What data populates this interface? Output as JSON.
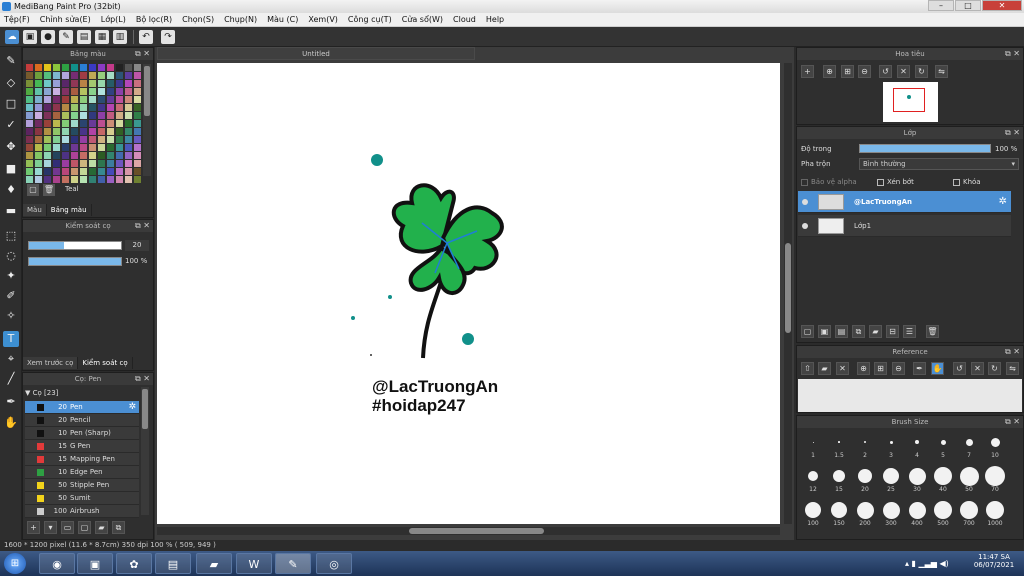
{
  "window": {
    "title": "MediBang Paint Pro (32bit)"
  },
  "menu": [
    "Tệp(F)",
    "Chỉnh sửa(E)",
    "Lớp(L)",
    "Bộ lọc(R)",
    "Chọn(S)",
    "Chụp(N)",
    "Màu (C)",
    "Xem(V)",
    "Công cụ(T)",
    "Cửa sổ(W)",
    "Cloud",
    "Help"
  ],
  "color_panel": {
    "title": "Bảng màu",
    "color_name": "Teal",
    "tab_color": "Màu",
    "tab_palette": "Bảng màu"
  },
  "brush_control": {
    "title": "Kiểm soát cọ",
    "size": "20",
    "opacity": "100 %",
    "tab_preview": "Xem trước cọ",
    "tab_control": "Kiểm soát cọ"
  },
  "brush_panel": {
    "title": "Cọ: Pen",
    "group": "Cọ [23]",
    "items": [
      {
        "size": "20",
        "name": "Pen",
        "color": "#111111"
      },
      {
        "size": "20",
        "name": "Pencil",
        "color": "#111111"
      },
      {
        "size": "10",
        "name": "Pen (Sharp)",
        "color": "#111111"
      },
      {
        "size": "15",
        "name": "G Pen",
        "color": "#e23a3a"
      },
      {
        "size": "15",
        "name": "Mapping Pen",
        "color": "#e23a3a"
      },
      {
        "size": "10",
        "name": "Edge Pen",
        "color": "#2ea043"
      },
      {
        "size": "50",
        "name": "Stipple Pen",
        "color": "#f2d31b"
      },
      {
        "size": "50",
        "name": "Sumit",
        "color": "#f2d31b"
      },
      {
        "size": "100",
        "name": "Airbrush",
        "color": "#cccccc"
      }
    ]
  },
  "canvas": {
    "doc_title": "Untitled",
    "handle": "@LacTruongAn",
    "hashtag": "#hoidap247"
  },
  "navigator": {
    "title": "Hoa tiêu"
  },
  "layer_panel": {
    "title": "Lớp",
    "opacity_label": "Độ trong",
    "opacity_value": "100 %",
    "blend_label": "Pha trộn",
    "blend_value": "Bình thường",
    "protect_alpha": "Bảo vệ alpha",
    "clipping": "Xén bớt",
    "lock": "Khóa",
    "layers": [
      {
        "name": "@LacTruongAn"
      },
      {
        "name": "Lớp1"
      }
    ]
  },
  "reference": {
    "title": "Reference"
  },
  "brush_size": {
    "title": "Brush Size",
    "sizes": [
      "1",
      "1.5",
      "2",
      "3",
      "4",
      "5",
      "7",
      "10",
      "12",
      "15",
      "20",
      "25",
      "30",
      "40",
      "50",
      "70",
      "100",
      "150",
      "200",
      "300",
      "400",
      "500",
      "700",
      "1000"
    ]
  },
  "status": {
    "text": "1600 * 1200 pixel   (11.6 * 8.7cm)   350 dpi   100 %   ( 509, 949 )"
  },
  "taskbar": {
    "time": "11:47 SA",
    "date": "06/07/2021"
  },
  "colors": {
    "accent": "#4b8fd3",
    "teal": "#11908a",
    "clover": "#22b14c"
  }
}
